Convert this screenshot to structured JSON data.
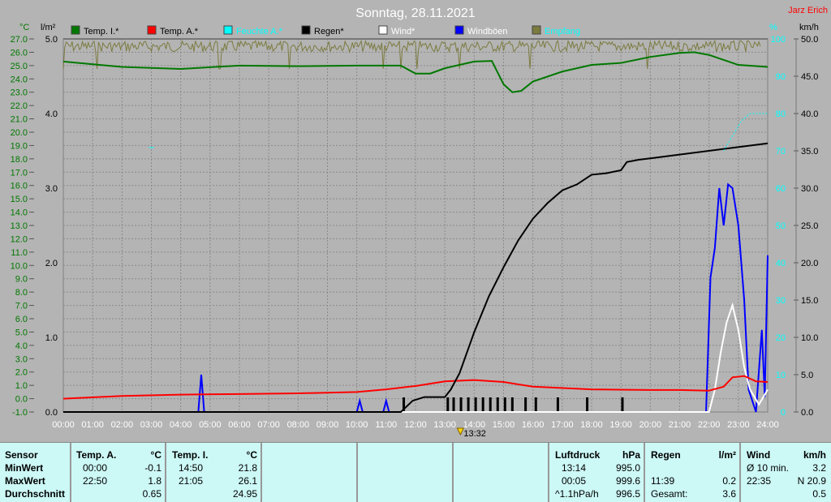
{
  "title": "Sonntag, 28.11.2021",
  "author": "Jarz Erich",
  "axis_units": {
    "celsius": "°C",
    "rain": "l/m²",
    "percent": "%",
    "kmh": "km/h"
  },
  "legend": [
    {
      "label": "Temp. I.*",
      "color": "#007800",
      "text_color": "#000"
    },
    {
      "label": "Temp. A.*",
      "color": "#ff0000",
      "text_color": "#000"
    },
    {
      "label": "Feuchte A.*",
      "color": "#00ffff",
      "text_color": "#00ffff"
    },
    {
      "label": "Regen*",
      "color": "#000000",
      "text_color": "#000"
    },
    {
      "label": "Wind*",
      "color": "#ffffff",
      "text_color": "#fff"
    },
    {
      "label": "Windböen",
      "color": "#0000ff",
      "text_color": "#fff"
    },
    {
      "label": "Empfang",
      "color": "#7b7b40",
      "text_color": "#00ffff"
    }
  ],
  "marker": {
    "label": "13:32",
    "hour": 13.53
  },
  "chart_data": {
    "type": "line",
    "title": "Sonntag, 28.11.2021",
    "x_ticks": [
      "00:00",
      "01:00",
      "02:00",
      "03:00",
      "04:00",
      "05:00",
      "06:00",
      "07:00",
      "08:00",
      "09:00",
      "10:00",
      "11:00",
      "12:00",
      "13:00",
      "14:00",
      "15:00",
      "16:00",
      "17:00",
      "18:00",
      "19:00",
      "20:00",
      "21:00",
      "22:00",
      "23:00",
      "24:00"
    ],
    "xlim": [
      0,
      24
    ],
    "y_celsius": {
      "range": [
        -1,
        27
      ],
      "ticks": [
        "27.0",
        "26.0",
        "25.0",
        "24.0",
        "23.0",
        "22.0",
        "21.0",
        "20.0",
        "19.0",
        "18.0",
        "17.0",
        "16.0",
        "15.0",
        "14.0",
        "13.0",
        "12.0",
        "11.0",
        "10.0",
        "9.0",
        "8.0",
        "7.0",
        "6.0",
        "5.0",
        "4.0",
        "3.0",
        "2.0",
        "1.0",
        "0.0",
        "-1.0"
      ]
    },
    "y_rain": {
      "range": [
        0,
        5
      ],
      "ticks": [
        "5.0",
        "4.0",
        "3.0",
        "2.0",
        "1.0",
        "0.0"
      ]
    },
    "y_percent": {
      "range": [
        0,
        100
      ],
      "ticks": [
        "100",
        "90",
        "80",
        "70",
        "60",
        "50",
        "40",
        "30",
        "20",
        "10",
        "0"
      ]
    },
    "y_kmh": {
      "range": [
        0,
        50
      ],
      "ticks": [
        "50.0",
        "45.0",
        "40.0",
        "35.0",
        "30.0",
        "25.0",
        "20.0",
        "15.0",
        "10.0",
        "5.0",
        "0.0"
      ]
    },
    "series": [
      {
        "name": "Temp. I.*",
        "axis": "celsius",
        "color": "#007800",
        "x": [
          0,
          2,
          4,
          6,
          8,
          10,
          11.5,
          12,
          12.5,
          13,
          14,
          14.6,
          15,
          15.3,
          15.6,
          16,
          17,
          18,
          19,
          20,
          21,
          21.5,
          22,
          23,
          24
        ],
        "y": [
          25.3,
          24.9,
          24.75,
          25.0,
          24.95,
          25.0,
          25.0,
          24.4,
          24.4,
          24.8,
          25.3,
          25.35,
          23.6,
          23.0,
          23.1,
          23.8,
          24.55,
          25.05,
          25.2,
          25.65,
          25.95,
          26.0,
          25.8,
          25.05,
          24.9
        ]
      },
      {
        "name": "Temp. A.*",
        "axis": "celsius",
        "color": "#ff0000",
        "x": [
          0,
          2,
          4,
          6,
          8,
          10,
          11,
          12,
          13,
          14,
          15,
          16,
          18,
          20,
          21,
          22,
          22.5,
          22.8,
          23.2,
          23.6,
          24
        ],
        "y": [
          0.0,
          0.2,
          0.3,
          0.35,
          0.4,
          0.5,
          0.7,
          0.95,
          1.3,
          1.4,
          1.25,
          0.9,
          0.7,
          0.65,
          0.65,
          0.6,
          0.9,
          1.6,
          1.7,
          1.3,
          1.25
        ]
      },
      {
        "name": "Feuchte A.*",
        "axis": "percent",
        "color": "#00ffff",
        "x": [
          22.5,
          22.8,
          23.1,
          23.4,
          23.7,
          24
        ],
        "y": [
          70,
          74,
          78,
          80,
          80,
          80
        ],
        "points": [
          [
            3.0,
            71
          ]
        ]
      },
      {
        "name": "Regen*",
        "axis": "rain",
        "color": "#000000",
        "x": [
          0,
          11.5,
          11.9,
          12.3,
          13,
          13.2,
          13.5,
          14,
          14.5,
          15,
          15.5,
          16,
          16.5,
          17,
          17.5,
          18,
          18.5,
          19,
          19.2,
          19.6,
          20,
          24
        ],
        "y": [
          0,
          0,
          0.15,
          0.2,
          0.2,
          0.3,
          0.52,
          1.07,
          1.55,
          1.94,
          2.3,
          2.59,
          2.8,
          2.97,
          3.05,
          3.18,
          3.2,
          3.24,
          3.35,
          3.38,
          3.4,
          3.6
        ]
      },
      {
        "name": "Wind*",
        "axis": "kmh",
        "color": "#ffffff",
        "x": [
          0,
          22,
          22.2,
          22.4,
          22.6,
          22.8,
          23,
          23.2,
          23.4,
          23.7,
          24
        ],
        "y": [
          0,
          0,
          3,
          8,
          12,
          14.3,
          11,
          6,
          3,
          1,
          3
        ]
      },
      {
        "name": "Windböen",
        "axis": "kmh",
        "color": "#0000ff",
        "x": [
          0,
          4.6,
          4.7,
          4.8,
          10.0,
          10.1,
          10.2,
          10.9,
          11.0,
          11.1,
          21.9,
          22.05,
          22.2,
          22.35,
          22.5,
          22.65,
          22.8,
          23.0,
          23.2,
          23.35,
          23.6,
          23.8,
          23.9,
          24
        ],
        "y": [
          0,
          0,
          5,
          0,
          0,
          1.5,
          0,
          0,
          1.5,
          0,
          0,
          18,
          22,
          30,
          25,
          30.5,
          30,
          25,
          15,
          3,
          0,
          11,
          2,
          21
        ]
      },
      {
        "name": "Empfang",
        "axis": "percent",
        "color": "#7b7b40",
        "mean": 99
      }
    ],
    "rain_bars": {
      "color": "#000000",
      "x": [
        11.6,
        13.1,
        13.3,
        13.55,
        13.8,
        14.05,
        14.3,
        14.55,
        14.8,
        15.05,
        15.3,
        15.75,
        16.1,
        16.85,
        17.85,
        19.05
      ]
    }
  },
  "table": {
    "sensor": {
      "header": "Sensor",
      "rows": [
        "MinWert",
        "MaxWert",
        "Durchschnitt"
      ]
    },
    "temp_a": {
      "header": "Temp. A.",
      "unit": "°C",
      "rows": [
        [
          "00:00",
          "-0.1"
        ],
        [
          "22:50",
          "1.8"
        ],
        [
          "",
          "0.65"
        ]
      ]
    },
    "temp_i": {
      "header": "Temp. I.",
      "unit": "°C",
      "rows": [
        [
          "14:50",
          "21.8"
        ],
        [
          "21:05",
          "26.1"
        ],
        [
          "",
          "24.95"
        ]
      ]
    },
    "pressure": {
      "header": "Luftdruck",
      "unit": "hPa",
      "rows": [
        [
          "13:14",
          "995.0"
        ],
        [
          "00:05",
          "999.6"
        ],
        [
          "^1.1hPa/h",
          "996.5"
        ]
      ]
    },
    "rain": {
      "header": "Regen",
      "unit": "l/m²",
      "rows": [
        [
          "",
          ""
        ],
        [
          "11:39",
          "0.2"
        ],
        [
          "Gesamt:",
          "3.6"
        ]
      ]
    },
    "wind": {
      "header": "Wind",
      "unit": "km/h",
      "rows": [
        [
          "Ø 10 min.",
          "3.2"
        ],
        [
          "22:35",
          "N 20.9"
        ],
        [
          "",
          "0.5"
        ]
      ]
    }
  }
}
